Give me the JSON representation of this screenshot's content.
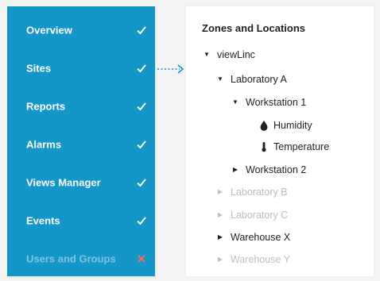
{
  "sidebar": {
    "items": [
      {
        "label": "Overview",
        "status": "check"
      },
      {
        "label": "Sites",
        "status": "check"
      },
      {
        "label": "Reports",
        "status": "check"
      },
      {
        "label": "Alarms",
        "status": "check"
      },
      {
        "label": "Views Manager",
        "status": "check"
      },
      {
        "label": "Events",
        "status": "check"
      },
      {
        "label": "Users and Groups",
        "status": "cross"
      }
    ],
    "colors": {
      "background": "#1596c8",
      "check": "#ffffff",
      "cross": "#f06a6a"
    }
  },
  "panel": {
    "title": "Zones and Locations",
    "tree": {
      "root": "viewLinc",
      "lab_a": "Laboratory A",
      "ws1": "Workstation 1",
      "humidity": "Humidity",
      "temperature": "Temperature",
      "ws2": "Workstation 2",
      "lab_b": "Laboratory B",
      "lab_c": "Laboratory C",
      "warehouse_x": "Warehouse X",
      "warehouse_y": "Warehouse Y"
    },
    "icons": {
      "expanded": "caret-down-icon",
      "collapsed": "caret-right-icon",
      "humidity": "droplet-icon",
      "temperature": "thermometer-icon"
    }
  }
}
